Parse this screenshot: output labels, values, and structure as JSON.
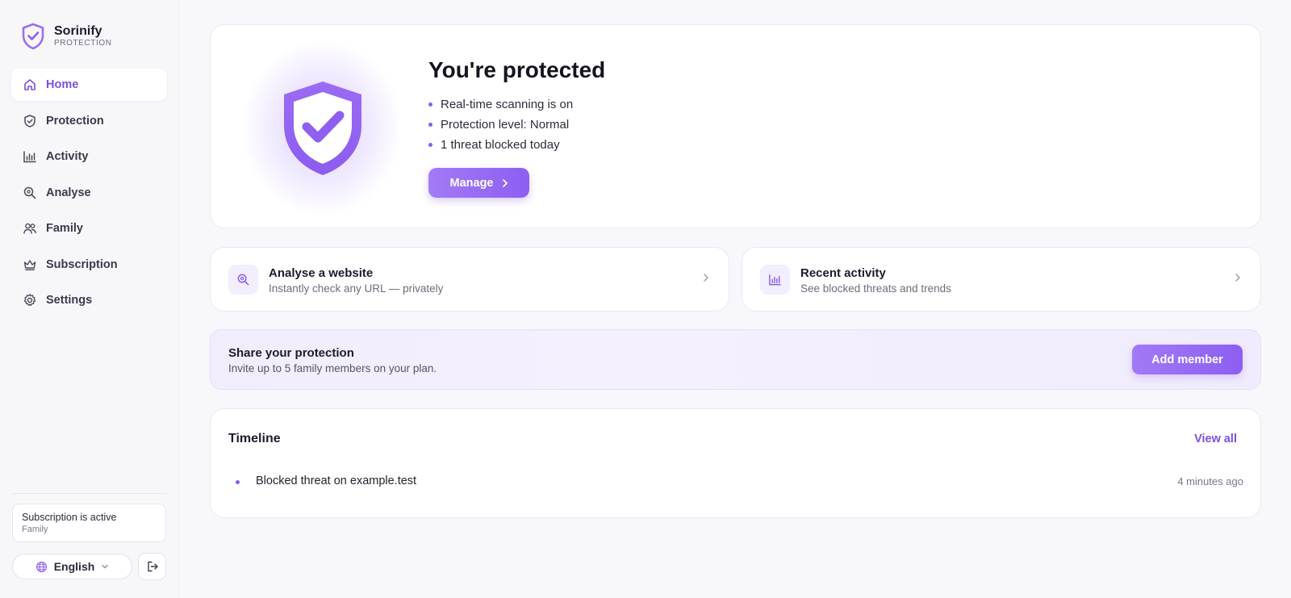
{
  "brand": {
    "name": "Sorinify",
    "subtitle": "PROTECTION",
    "accent": "#8a5cf0"
  },
  "sidebar": {
    "items": [
      {
        "label": "Home",
        "icon": "home-icon",
        "active": true
      },
      {
        "label": "Protection",
        "icon": "shield-icon",
        "active": false
      },
      {
        "label": "Activity",
        "icon": "bar-chart-icon",
        "active": false
      },
      {
        "label": "Analyse",
        "icon": "search-icon",
        "active": false
      },
      {
        "label": "Family",
        "icon": "people-icon",
        "active": false
      },
      {
        "label": "Subscription",
        "icon": "crown-icon",
        "active": false
      },
      {
        "label": "Settings",
        "icon": "gear-icon",
        "active": false
      }
    ],
    "subscription": {
      "status": "Subscription is active",
      "plan": "Family"
    },
    "language": "English"
  },
  "hero": {
    "title": "You're protected",
    "bullets": [
      "Real-time scanning is on",
      "Protection level: Normal",
      "1 threat blocked today"
    ],
    "manage_label": "Manage"
  },
  "tiles": {
    "analyse": {
      "title": "Analyse a website",
      "subtitle": "Instantly check any URL — privately"
    },
    "activity": {
      "title": "Recent activity",
      "subtitle": "See blocked threats and trends"
    }
  },
  "share": {
    "title": "Share your protection",
    "subtitle": "Invite up to 5 family members on your plan.",
    "button_label": "Add member"
  },
  "timeline": {
    "title": "Timeline",
    "view_all": "View all",
    "events": [
      {
        "text": "Blocked threat on example.test",
        "time": "4 minutes ago"
      }
    ]
  }
}
